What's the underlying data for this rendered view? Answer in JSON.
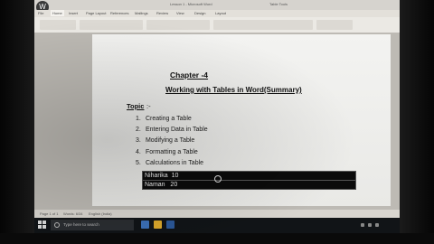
{
  "window": {
    "title": "Lesson 1 - Microsoft Word",
    "title_right": "Table Tools"
  },
  "ribbon": {
    "tabs": [
      "File",
      "Home",
      "Insert",
      "Page Layout",
      "References",
      "Mailings",
      "Review",
      "View",
      "Design",
      "Layout"
    ],
    "active_tab_index": 1
  },
  "document": {
    "chapter": "Chapter -4",
    "subtitle": "Working with Tables in Word(Summary)",
    "topic_label": "Topic",
    "topic_suffix": ":-",
    "topics": [
      {
        "num": "1.",
        "text": "Creating a Table"
      },
      {
        "num": "2.",
        "text": "Entering Data in Table"
      },
      {
        "num": "3.",
        "text": "Modifying a Table"
      },
      {
        "num": "4.",
        "text": "Formatting a Table"
      },
      {
        "num": "5.",
        "text": "Calculations in Table"
      }
    ],
    "table_rows": [
      [
        "Niharika",
        "10"
      ],
      [
        "Naman",
        "20"
      ]
    ]
  },
  "statusbar": {
    "page": "Page 1 of 1",
    "words": "Words: 6/34",
    "language": "English (India)"
  },
  "taskbar": {
    "search_placeholder": "Type here to search"
  },
  "colors": {
    "table_bg": "#0b0b0b",
    "taskbar": "#111417",
    "page": "#f3f3f1"
  }
}
